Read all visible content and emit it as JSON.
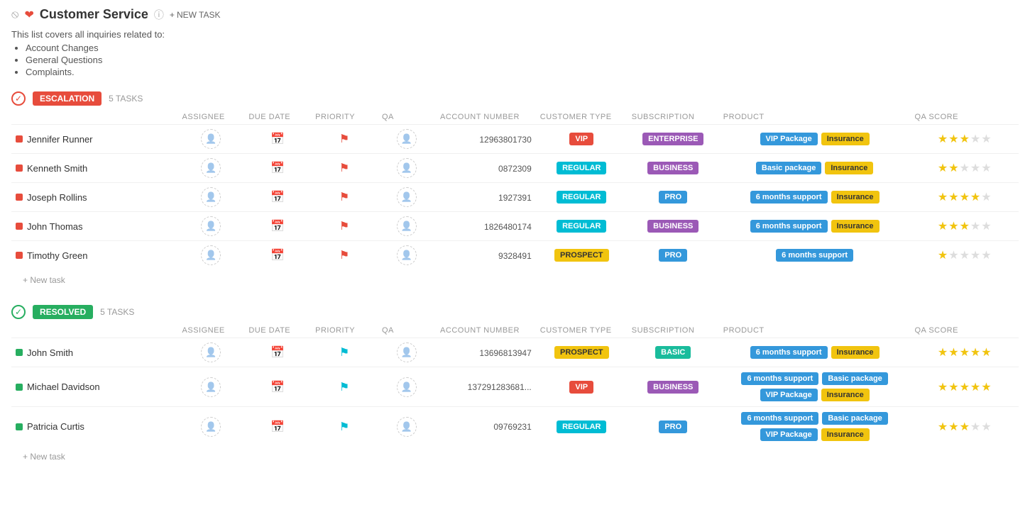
{
  "header": {
    "title": "Customer Service",
    "info_icon": "info-icon",
    "new_task_label": "NEW TASK"
  },
  "description": {
    "intro": "This list covers all inquiries related to:",
    "items": [
      "Account Changes",
      "General Questions",
      "Complaints."
    ]
  },
  "sections": [
    {
      "id": "escalation",
      "badge_label": "ESCALATION",
      "type": "escalation",
      "task_count_label": "5 TASKS",
      "columns": [
        "ASSIGNEE",
        "DUE DATE",
        "PRIORITY",
        "QA",
        "ACCOUNT NUMBER",
        "CUSTOMER TYPE",
        "SUBSCRIPTION",
        "PRODUCT",
        "QA SCORE"
      ],
      "tasks": [
        {
          "name": "Jennifer Runner",
          "account_number": "12963801730",
          "customer_type": "VIP",
          "customer_type_class": "vip",
          "subscription": "ENTERPRISE",
          "subscription_class": "enterprise",
          "products": [
            {
              "label": "VIP Package",
              "class": "vip-package"
            },
            {
              "label": "Insurance",
              "class": "insurance"
            }
          ],
          "stars": [
            1,
            1,
            1,
            0,
            0
          ],
          "flag_color": "red"
        },
        {
          "name": "Kenneth Smith",
          "account_number": "0872309",
          "customer_type": "REGULAR",
          "customer_type_class": "regular",
          "subscription": "BUSINESS",
          "subscription_class": "business",
          "products": [
            {
              "label": "Basic package",
              "class": "basic-package"
            },
            {
              "label": "Insurance",
              "class": "insurance"
            }
          ],
          "stars": [
            1,
            1,
            0,
            0,
            0
          ],
          "flag_color": "red"
        },
        {
          "name": "Joseph Rollins",
          "account_number": "1927391",
          "customer_type": "REGULAR",
          "customer_type_class": "regular",
          "subscription": "PRO",
          "subscription_class": "pro",
          "products": [
            {
              "label": "6 months support",
              "class": "6months"
            },
            {
              "label": "Insurance",
              "class": "insurance"
            }
          ],
          "stars": [
            1,
            1,
            1,
            1,
            0
          ],
          "flag_color": "red"
        },
        {
          "name": "John Thomas",
          "account_number": "1826480174",
          "customer_type": "REGULAR",
          "customer_type_class": "regular",
          "subscription": "BUSINESS",
          "subscription_class": "business",
          "products": [
            {
              "label": "6 months support",
              "class": "6months"
            },
            {
              "label": "Insurance",
              "class": "insurance"
            }
          ],
          "stars": [
            1,
            1,
            1,
            0,
            0
          ],
          "flag_color": "red"
        },
        {
          "name": "Timothy Green",
          "account_number": "9328491",
          "customer_type": "PROSPECT",
          "customer_type_class": "prospect",
          "subscription": "PRO",
          "subscription_class": "pro",
          "products": [
            {
              "label": "6 months support",
              "class": "6months"
            }
          ],
          "stars": [
            1,
            0,
            0,
            0,
            0
          ],
          "flag_color": "red"
        }
      ],
      "new_task_label": "+ New task"
    },
    {
      "id": "resolved",
      "badge_label": "RESOLVED",
      "type": "resolved",
      "task_count_label": "5 TASKS",
      "columns": [
        "ASSIGNEE",
        "DUE DATE",
        "PRIORITY",
        "QA",
        "ACCOUNT NUMBER",
        "CUSTOMER TYPE",
        "SUBSCRIPTION",
        "PRODUCT",
        "QA SCORE"
      ],
      "tasks": [
        {
          "name": "John Smith",
          "account_number": "13696813947",
          "customer_type": "PROSPECT",
          "customer_type_class": "prospect",
          "subscription": "BASIC",
          "subscription_class": "basic",
          "products": [
            {
              "label": "6 months support",
              "class": "6months"
            },
            {
              "label": "Insurance",
              "class": "insurance"
            }
          ],
          "stars": [
            1,
            1,
            1,
            1,
            1
          ],
          "flag_color": "cyan"
        },
        {
          "name": "Michael Davidson",
          "account_number": "137291283681...",
          "customer_type": "VIP",
          "customer_type_class": "vip",
          "subscription": "BUSINESS",
          "subscription_class": "business",
          "products": [
            {
              "label": "6 months support",
              "class": "6months"
            },
            {
              "label": "Basic package",
              "class": "basic-package"
            },
            {
              "label": "VIP Package",
              "class": "vip-package"
            },
            {
              "label": "Insurance",
              "class": "insurance"
            }
          ],
          "stars": [
            1,
            1,
            1,
            1,
            1
          ],
          "flag_color": "cyan"
        },
        {
          "name": "Patricia Curtis",
          "account_number": "09769231",
          "customer_type": "REGULAR",
          "customer_type_class": "regular",
          "subscription": "PRO",
          "subscription_class": "pro",
          "products": [
            {
              "label": "6 months support",
              "class": "6months"
            },
            {
              "label": "Basic package",
              "class": "basic-package"
            },
            {
              "label": "VIP Package",
              "class": "vip-package"
            },
            {
              "label": "Insurance",
              "class": "insurance"
            }
          ],
          "stars": [
            1,
            1,
            1,
            0,
            0
          ],
          "flag_color": "cyan"
        }
      ],
      "new_task_label": "+ New task"
    }
  ]
}
